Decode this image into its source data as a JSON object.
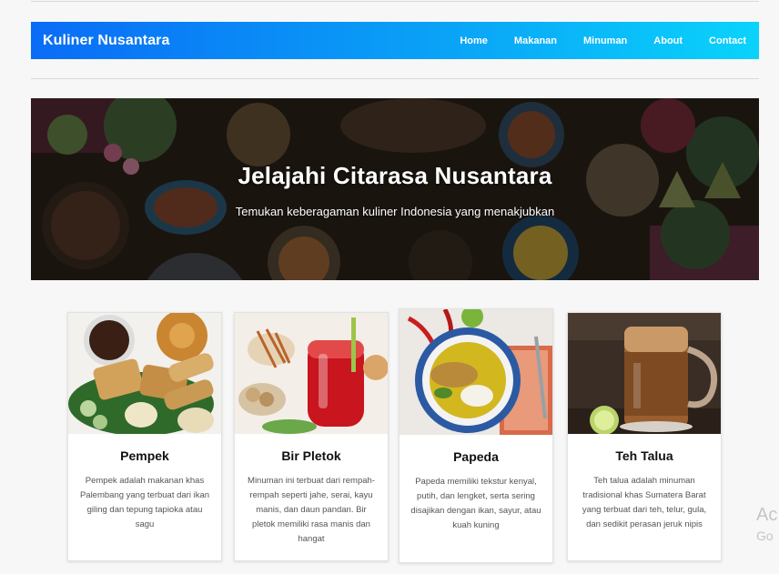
{
  "navbar": {
    "brand": "Kuliner Nusantara",
    "menu": [
      "Home",
      "Makanan",
      "Minuman",
      "About",
      "Contact"
    ]
  },
  "hero": {
    "title": "Jelajahi Citarasa Nusantara",
    "subtitle": "Temukan keberagaman kuliner Indonesia yang menakjubkan"
  },
  "cards": [
    {
      "title": "Pempek",
      "description": "Pempek adalah makanan khas Palembang yang terbuat dari ikan giling dan tepung tapioka atau sagu"
    },
    {
      "title": "Bir Pletok",
      "description": "Minuman ini terbuat dari rempah-rempah seperti jahe, serai, kayu manis, dan daun pandan. Bir pletok memiliki rasa manis dan hangat"
    },
    {
      "title": "Papeda",
      "description": "Papeda memiliki tekstur kenyal, putih, dan lengket, serta sering disajikan dengan ikan, sayur, atau kuah kuning"
    },
    {
      "title": "Teh Talua",
      "description": "Teh talua adalah minuman tradisional khas Sumatera Barat yang terbuat dari teh, telur, gula, dan sedikit perasan jeruk nipis"
    }
  ],
  "watermark": {
    "line1": "Ac",
    "line2": "Go"
  },
  "colors": {
    "navbar_start": "#0a6cf6",
    "navbar_end": "#0ad3fb"
  }
}
